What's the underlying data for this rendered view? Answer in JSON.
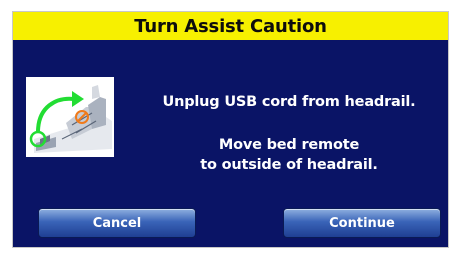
{
  "dialog": {
    "title": "Turn Assist Caution",
    "message_1": "Unplug USB cord from headrail.",
    "message_2_line_1": "Move bed remote",
    "message_2_line_2": "to outside of headrail."
  },
  "buttons": {
    "cancel_label": "Cancel",
    "continue_label": "Continue"
  },
  "colors": {
    "title_bar": "#f7f000",
    "panel": "#0a1466",
    "button": "#3a64b8",
    "arrow": "#22dd33"
  }
}
